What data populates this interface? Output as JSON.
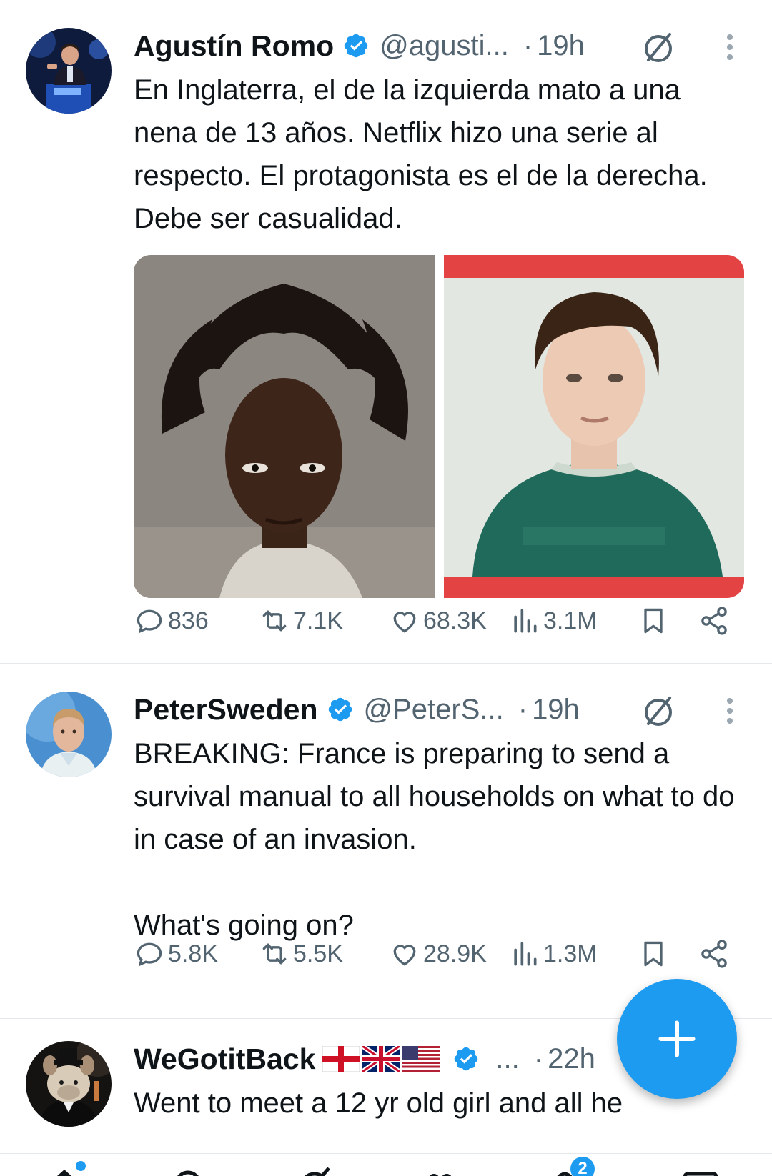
{
  "colors": {
    "accent": "#1d9bf0",
    "text_primary": "#0f1419",
    "text_secondary": "#536471",
    "divider": "#e6e9ec"
  },
  "tweets": [
    {
      "name": "Agustín Romo",
      "verified": true,
      "handle": "@agusti...",
      "dot": "·",
      "time": "19h",
      "text": "En Inglaterra, el de la izquierda mato a una nena de 13 años. Netflix hizo una serie al respecto. El protagonista es el de la derecha. Debe ser casualidad.",
      "media": [
        "photo-young-man-mugshot",
        "photo-boy-green-shirt"
      ],
      "stats": {
        "replies": "836",
        "reposts": "7.1K",
        "likes": "68.3K",
        "views": "3.1M"
      }
    },
    {
      "name": "PeterSweden",
      "verified": true,
      "handle": "@PeterS...",
      "dot": "·",
      "time": "19h",
      "text": "BREAKING: France is preparing to send a survival manual to all households on what to do in case of an invasion.\n\nWhat's going on?",
      "stats": {
        "replies": "5.8K",
        "reposts": "5.5K",
        "likes": "28.9K",
        "views": "1.3M"
      }
    },
    {
      "name": "WeGotitBack",
      "flags": [
        "england-flag",
        "uk-flag",
        "us-flag"
      ],
      "verified": true,
      "handle": "...",
      "dot": "·",
      "time": "22h",
      "text": "Went to meet a 12 yr old girl and all he"
    }
  ],
  "fab": {
    "icon": "plus-icon"
  },
  "bottom_nav": {
    "items": [
      "home-icon",
      "search-icon",
      "grok-icon",
      "communities-icon",
      "notifications-icon",
      "messages-icon"
    ],
    "notifications_badge": "2"
  }
}
